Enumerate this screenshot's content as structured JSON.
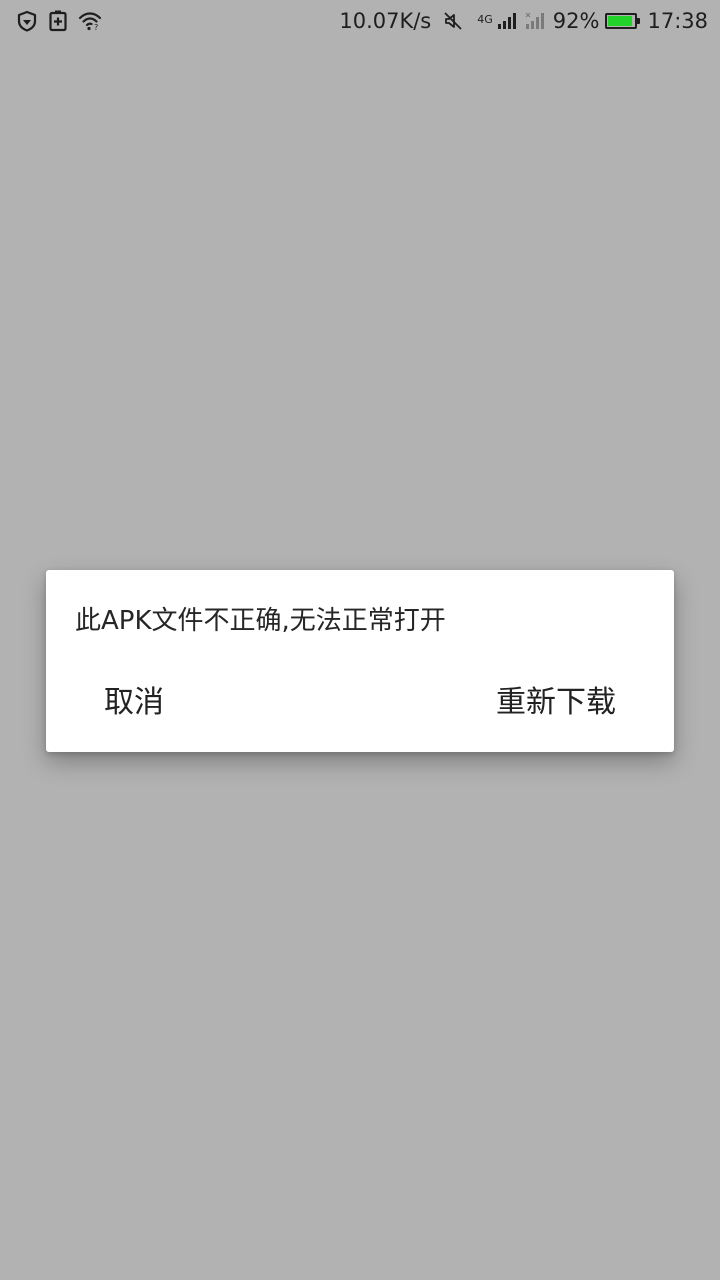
{
  "status_bar": {
    "net_speed": "10.07K/s",
    "network_type": "4G",
    "battery_percent_text": "92%",
    "battery_level": 0.92,
    "battery_color": "#22d42a",
    "time": "17:38",
    "icons": [
      "shield-icon",
      "battery-saver-icon",
      "wifi-icon",
      "mute-icon",
      "signal-4g-icon",
      "signal-sim2-icon",
      "battery-icon"
    ]
  },
  "dialog": {
    "message": "此APK文件不正确,无法正常打开",
    "cancel_label": "取消",
    "redownload_label": "重新下载"
  },
  "colors": {
    "scrim": "#b2b2b2",
    "dialog_bg": "#ffffff",
    "text": "#222222"
  }
}
